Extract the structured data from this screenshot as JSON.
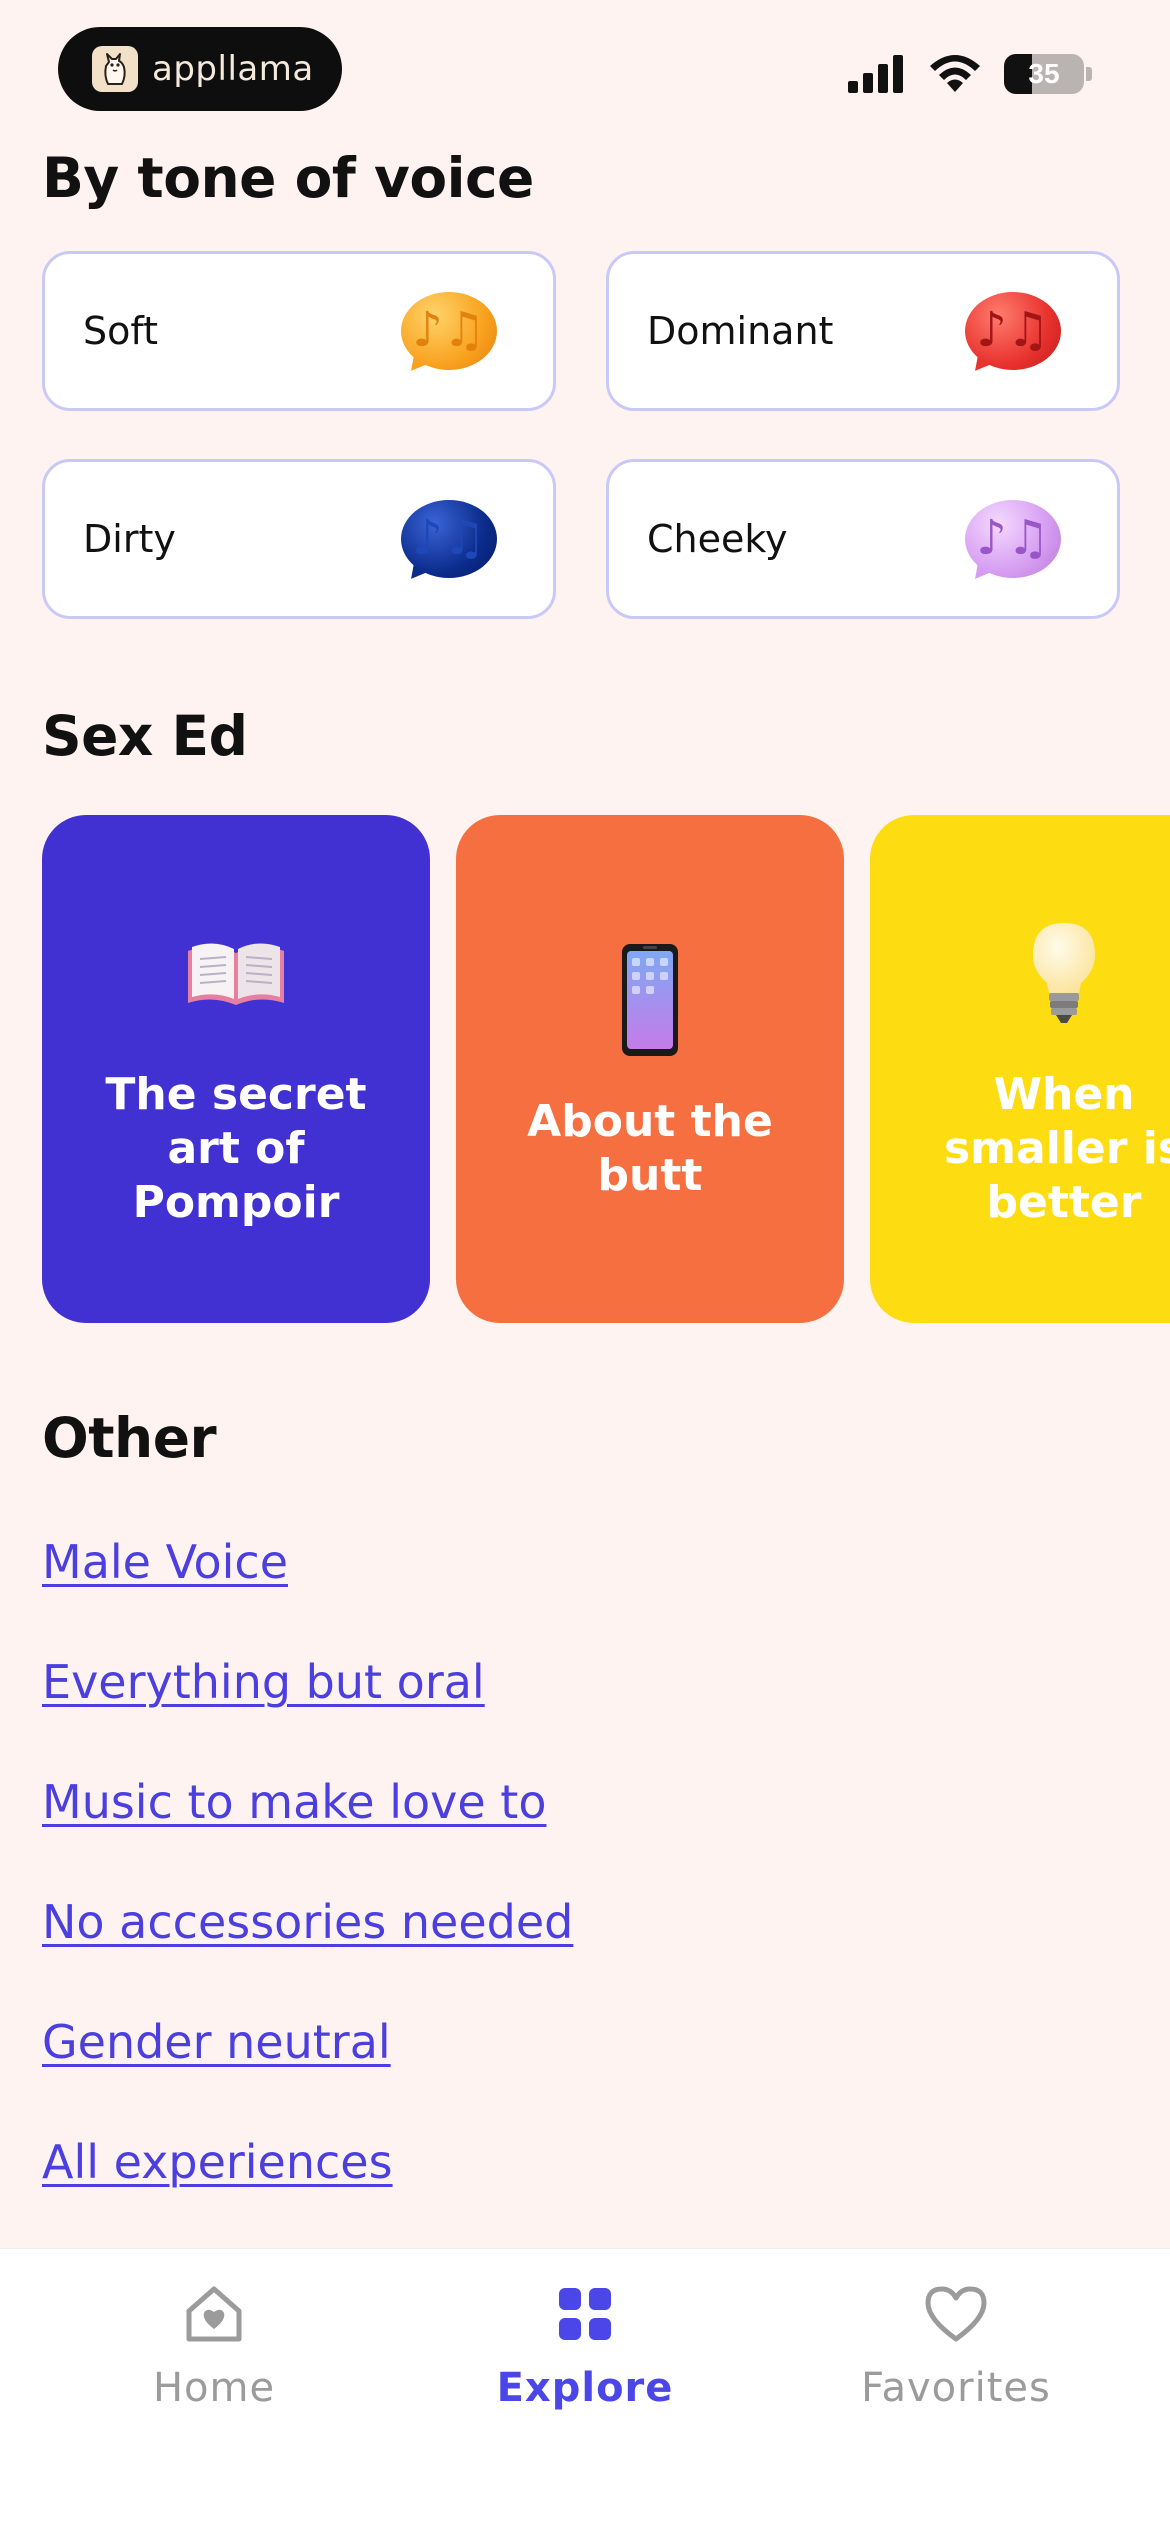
{
  "status_bar": {
    "app_name": "appllama",
    "battery_percent": 35
  },
  "tone_section": {
    "title": "By tone of voice",
    "items": [
      {
        "label": "Soft",
        "icon": "orange-music-bubble-icon",
        "color": "#F9A21F"
      },
      {
        "label": "Dominant",
        "icon": "red-music-bubble-icon",
        "color": "#E8322E"
      },
      {
        "label": "Dirty",
        "icon": "navy-music-bubble-icon",
        "color": "#0B2C8C"
      },
      {
        "label": "Cheeky",
        "icon": "lilac-music-bubble-icon",
        "color": "#D59CF1"
      }
    ]
  },
  "sex_ed_section": {
    "title": "Sex Ed",
    "cards": [
      {
        "title": "The secret art of Pompoir",
        "icon": "open-book-icon",
        "color": "#4131D2"
      },
      {
        "title": "About the butt",
        "icon": "mobile-phone-icon",
        "color": "#F56F40"
      },
      {
        "title": "When smaller is better",
        "icon": "light-bulb-icon",
        "color": "#FEDC12"
      }
    ]
  },
  "other_section": {
    "title": "Other",
    "links": [
      "Male Voice",
      "Everything but oral",
      "Music to make love to",
      "No accessories needed",
      "Gender neutral",
      "All experiences"
    ]
  },
  "tab_bar": {
    "tabs": [
      {
        "label": "Home",
        "icon": "home-heart-icon",
        "active": false
      },
      {
        "label": "Explore",
        "icon": "grid-icon",
        "active": true
      },
      {
        "label": "Favorites",
        "icon": "heart-icon",
        "active": false
      }
    ],
    "active_color": "#4B46E8",
    "inactive_color": "#9B9B9B"
  }
}
